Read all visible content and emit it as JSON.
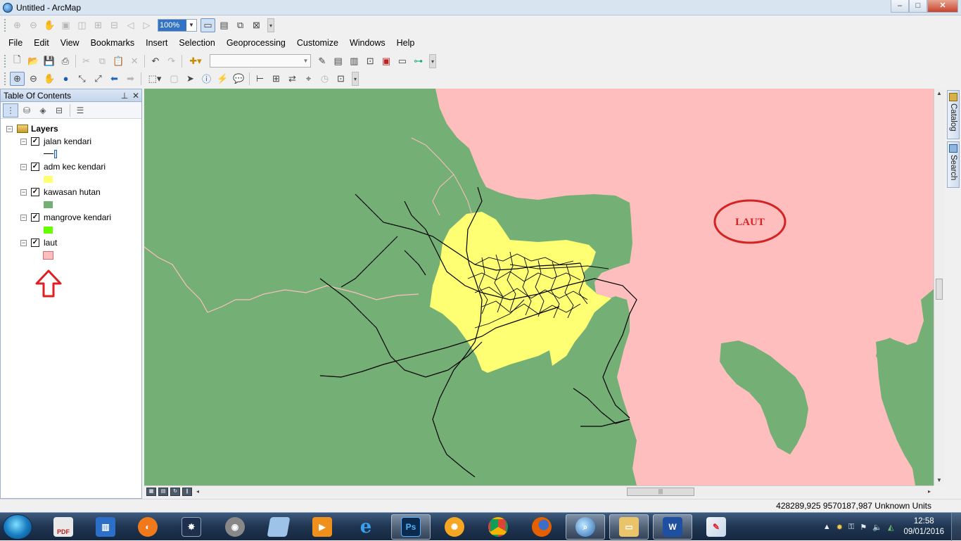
{
  "window": {
    "title": "Untitled - ArcMap",
    "min": "–",
    "max": "□",
    "close": "✕"
  },
  "top_toolbar": {
    "zoom_value": "100%"
  },
  "menu": [
    "File",
    "Edit",
    "View",
    "Bookmarks",
    "Insert",
    "Selection",
    "Geoprocessing",
    "Customize",
    "Windows",
    "Help"
  ],
  "toc": {
    "title": "Table Of Contents",
    "root": "Layers",
    "layers": [
      {
        "name": "jalan kendari",
        "checked": true,
        "symbol": "line",
        "color": "#000000"
      },
      {
        "name": "adm kec kendari",
        "checked": true,
        "symbol": "fill",
        "color": "#ffff73"
      },
      {
        "name": "kawasan hutan",
        "checked": true,
        "symbol": "fill",
        "color": "#74b075"
      },
      {
        "name": "mangrove kendari",
        "checked": true,
        "symbol": "fill",
        "color": "#66ff00"
      },
      {
        "name": "laut",
        "checked": true,
        "symbol": "fill",
        "color": "#ffbebe"
      }
    ],
    "annotation_arrow": "up-arrow-outline",
    "annotation_arrow_color": "#e02020"
  },
  "map": {
    "annotation_label": "LAUT",
    "annotation_color": "#d42323",
    "sea_color": "#ffbebe",
    "forest_color": "#74b075",
    "admin_color": "#ffff73"
  },
  "side_dock": {
    "catalog": "Catalog",
    "search": "Search"
  },
  "status": {
    "coordinates": "428289,925  9570187,987 Unknown Units"
  },
  "taskbar": {
    "apps": [
      "PDF",
      "book-icon",
      "office-icon",
      "movie-maker-icon",
      "media-center-icon",
      "notes-icon",
      "media-player-icon",
      "ie-icon",
      "Ps",
      "sparkle-icon",
      "chrome-icon",
      "firefox-icon",
      "arcmap-icon",
      "explorer-icon",
      "W",
      "paint-icon"
    ],
    "time": "12:58",
    "date": "09/01/2016"
  }
}
